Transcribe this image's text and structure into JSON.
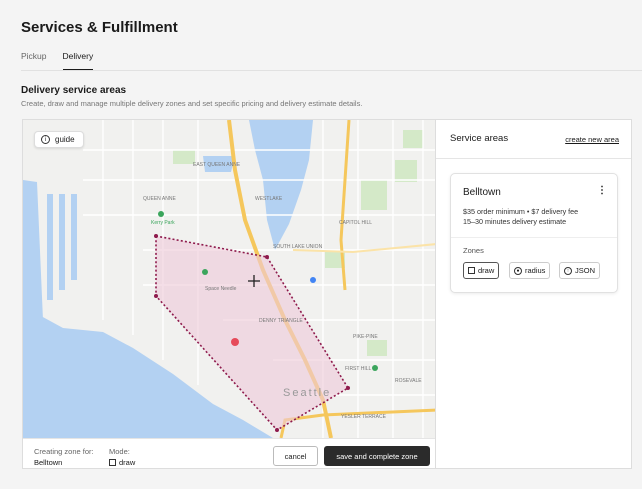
{
  "page": {
    "title": "Services & Fulfillment"
  },
  "tabs": [
    {
      "label": "Pickup",
      "active": false
    },
    {
      "label": "Delivery",
      "active": true
    }
  ],
  "section": {
    "title": "Delivery service areas",
    "description": "Create, draw and manage multiple delivery zones and set specific pricing and delivery estimate details."
  },
  "map": {
    "guide_label": "guide",
    "labels": [
      "EAST QUEEN ANNE",
      "QUEEN ANNE",
      "WESTLAKE",
      "SOUTH LAKE UNION",
      "CAPITOL HILL",
      "DENNY TRIANGLE",
      "Space Needle",
      "PIKE-PINE",
      "FIRST HILL",
      "Seattle",
      "YESLER TERRACE",
      "ROSEVALE",
      "Kerry Park"
    ],
    "cursor_icon": "move-cursor-icon",
    "bottom": {
      "creating_label": "Creating zone for:",
      "creating_value": "Belltown",
      "mode_label": "Mode:",
      "mode_value": "draw"
    },
    "cancel_label": "cancel",
    "save_label": "save and complete zone",
    "colors": {
      "water": "#b3d1f2",
      "land": "#f1f1ef",
      "zone_fill": "#efc9d8",
      "zone_stroke": "#8e1a4c",
      "highway": "#f5c75c",
      "park": "#d4e9c8"
    }
  },
  "panel": {
    "title": "Service areas",
    "create_link": "create new area",
    "card": {
      "name": "Belltown",
      "pricing": "$35 order minimum • $7 delivery fee",
      "estimate": "15–30 minutes delivery estimate",
      "zones_label": "Zones",
      "buttons": [
        {
          "label": "draw",
          "icon": "draw-square-icon",
          "active": true
        },
        {
          "label": "radius",
          "icon": "radius-icon",
          "active": false
        },
        {
          "label": "JSON",
          "icon": "upload-icon",
          "active": false
        }
      ]
    }
  }
}
